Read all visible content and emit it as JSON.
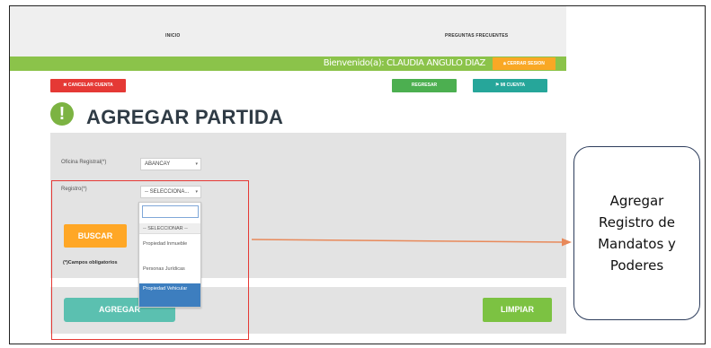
{
  "header": {
    "nav": [
      {
        "label": "INICIO"
      },
      {
        "label": "PREGUNTAS FRECUENTES"
      }
    ],
    "welcome_text": "Bienvenido(a): CLAUDIA ANGULO DIAZ",
    "logout_label": "CERRAR SESION",
    "logout_icon": "lock-icon"
  },
  "toolbar": {
    "cancel_label": "CANCELAR CUENTA",
    "cancel_icon": "close-icon",
    "back_label": "REGRESAR",
    "account_label": "MI CUENTA",
    "account_icon": "user-icon"
  },
  "page": {
    "title": "AGREGAR PARTIDA",
    "title_icon": "exclamation-icon",
    "title_icon_glyph": "!"
  },
  "form": {
    "office_label": "Oficina Registral(*)",
    "office_value": "ABANCAY",
    "registry_label": "Registro(*)",
    "registry_value": "-- SELECCIONA...",
    "required_note": "(*)Campos obligatorios",
    "search_button": "BUSCAR"
  },
  "dropdown": {
    "search_value": "",
    "options": [
      {
        "label": "-- SELECCIONAR --",
        "selected": false
      },
      {
        "label": "Propiedad Inmueble",
        "selected": false
      },
      {
        "label": "Personas Jurídicas",
        "selected": false
      },
      {
        "label": "Propiedad Vehicular",
        "selected": true
      }
    ]
  },
  "actions": {
    "add_button": "AGREGAR",
    "clear_button": "LIMPIAR"
  },
  "annotation": {
    "text": "Agregar\nRegistro de\nMandatos y\nPoderes"
  },
  "colors": {
    "green_bar": "#8bc34a",
    "cancel": "#e53935",
    "back": "#4caf50",
    "account": "#26a69a",
    "search": "#ffa726",
    "add": "#5bc0b0",
    "clear": "#7cc242",
    "highlight": "#e53935",
    "arrow": "#e8895a",
    "selected_option": "#3d7ebf"
  }
}
